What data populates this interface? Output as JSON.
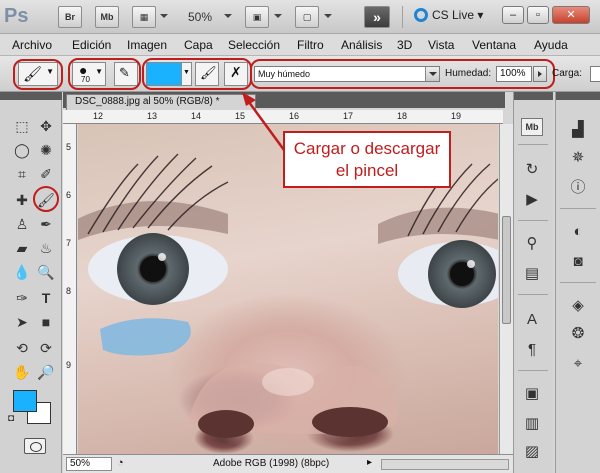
{
  "app": {
    "logo": "Ps",
    "bridge_label": "Br",
    "minibridge_label": "Mb",
    "zoom": "50%",
    "cs_live": "CS Live"
  },
  "menu": [
    "Archivo",
    "Edición",
    "Imagen",
    "Capa",
    "Selección",
    "Filtro",
    "Análisis",
    "3D",
    "Vista",
    "Ventana",
    "Ayuda"
  ],
  "options": {
    "brush_size": "70",
    "flow_preset": "Muy húmedo",
    "humedad_label": "Humedad:",
    "humedad_value": "100%",
    "carga_label": "Carga:"
  },
  "colors": {
    "foreground": "#1ab2ff",
    "background": "#ffffff",
    "highlight": "#c01d1d"
  },
  "document": {
    "tab_title": "DSC_0888.jpg al 50% (RGB/8) *",
    "close": "×",
    "ruler_top": [
      "12",
      "13",
      "14",
      "15",
      "16",
      "17",
      "18",
      "19"
    ],
    "ruler_left": [
      "5",
      "6",
      "7",
      "8",
      "9"
    ],
    "status_zoom": "50%",
    "status_profile": "Adobe RGB (1998) (8bpc)"
  },
  "annotation": {
    "callout_line1": "Cargar o descargar",
    "callout_line2": "el pincel"
  },
  "tools": [
    "rect-marquee",
    "move",
    "lasso",
    "quick-select",
    "crop",
    "eyedropper",
    "spot-heal",
    "brush",
    "clone-stamp",
    "history-brush",
    "eraser",
    "paint-bucket",
    "blur",
    "dodge",
    "pen",
    "type",
    "path-select",
    "shape",
    "3d-rotate",
    "3d-orbit",
    "hand",
    "zoom"
  ]
}
